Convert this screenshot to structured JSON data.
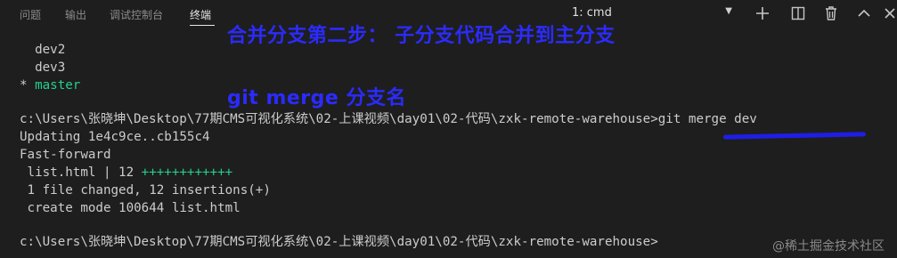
{
  "tabs": [
    "问题",
    "输出",
    "调试控制台",
    "终端"
  ],
  "active_tab": "终端",
  "terminal_selector": {
    "value": "1: cmd"
  },
  "toolbar_icons": [
    "plus-icon",
    "split-icon",
    "trash-icon",
    "chevron-up-icon",
    "close-icon"
  ],
  "annotations": {
    "title": "合并分支第二步： 子分支代码合并到主分支",
    "command": "git merge 分支名"
  },
  "terminal": {
    "lines": [
      "  dev2",
      "  dev3",
      "* master",
      "",
      "c:\\Users\\张晓坤\\Desktop\\77期CMS可视化系统\\02-上课视频\\day01\\02-代码\\zxk-remote-warehouse>git merge dev",
      "Updating 1e4c9ce..cb155c4",
      "Fast-forward",
      " list.html | 12 ",
      " 1 file changed, 12 insertions(+)",
      " create mode 100644 list.html",
      "",
      "c:\\Users\\张晓坤\\Desktop\\77期CMS可视化系统\\02-上课视频\\day01\\02-代码\\zxk-remote-warehouse>"
    ],
    "master_marker": "* ",
    "master_name": "master",
    "diffstat_plus": "++++++++++++"
  },
  "watermark": "@稀土掘金技术社区"
}
